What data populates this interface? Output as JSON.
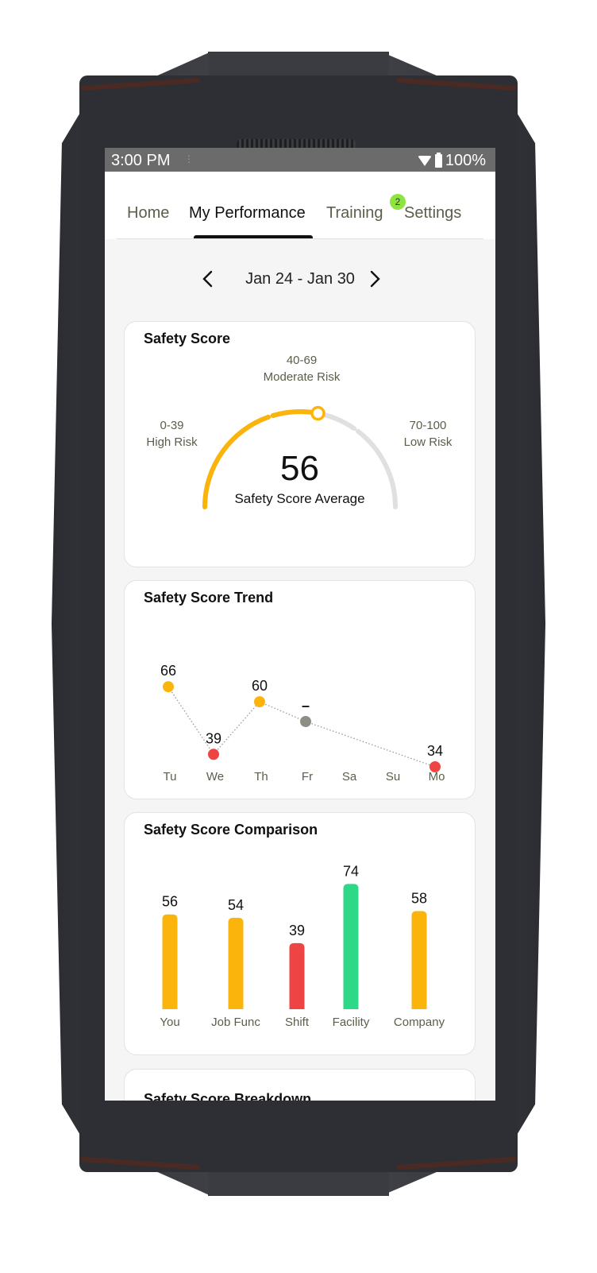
{
  "status_bar": {
    "time": "3:00 PM",
    "battery": "100%",
    "icons": [
      "wifi-icon",
      "battery-icon"
    ]
  },
  "tabs": [
    {
      "label": "Home",
      "active": false
    },
    {
      "label": "My Performance",
      "active": true
    },
    {
      "label": "Training",
      "active": false,
      "badge": "2"
    },
    {
      "label": "Settings",
      "active": false
    }
  ],
  "date_nav": {
    "label": "Jan 24 - Jan 30",
    "prev_icon": "chevron-left-icon",
    "next_icon": "chevron-right-icon"
  },
  "safety_score": {
    "title": "Safety Score",
    "value": "56",
    "value_num": 56,
    "caption": "Safety Score Average",
    "ranges": [
      {
        "range": "0-39",
        "label": "High Risk"
      },
      {
        "range": "40-69",
        "label": "Moderate Risk"
      },
      {
        "range": "70-100",
        "label": "Low Risk"
      }
    ],
    "colors": {
      "fill": "#fbb40b",
      "track": "#e0e0e0"
    }
  },
  "breakdown_card": {
    "title": "Safety Score Breakdown"
  },
  "chart_data": [
    {
      "type": "line",
      "title": "Safety Score Trend",
      "categories": [
        "Tu",
        "We",
        "Th",
        "Fr",
        "Sa",
        "Su",
        "Mo"
      ],
      "values": [
        66,
        39,
        60,
        null,
        null,
        null,
        34
      ],
      "labels": [
        "66",
        "39",
        "60",
        "–",
        "",
        "",
        "34"
      ],
      "no_data_marker": {
        "day": "Fr",
        "label": "–"
      },
      "point_colors": [
        "#fbb40b",
        "#ef4444",
        "#fbb40b",
        "#8d8e86",
        null,
        null,
        "#ef4444"
      ],
      "line_style": "dotted"
    },
    {
      "type": "bar",
      "title": "Safety Score Comparison",
      "categories": [
        "You",
        "Job Func",
        "Shift",
        "Facility",
        "Company"
      ],
      "values": [
        56,
        54,
        39,
        74,
        58
      ],
      "colors": [
        "#fbb40b",
        "#fbb40b",
        "#ef4444",
        "#2dd887",
        "#fbb40b"
      ],
      "ylim": [
        0,
        100
      ]
    }
  ]
}
